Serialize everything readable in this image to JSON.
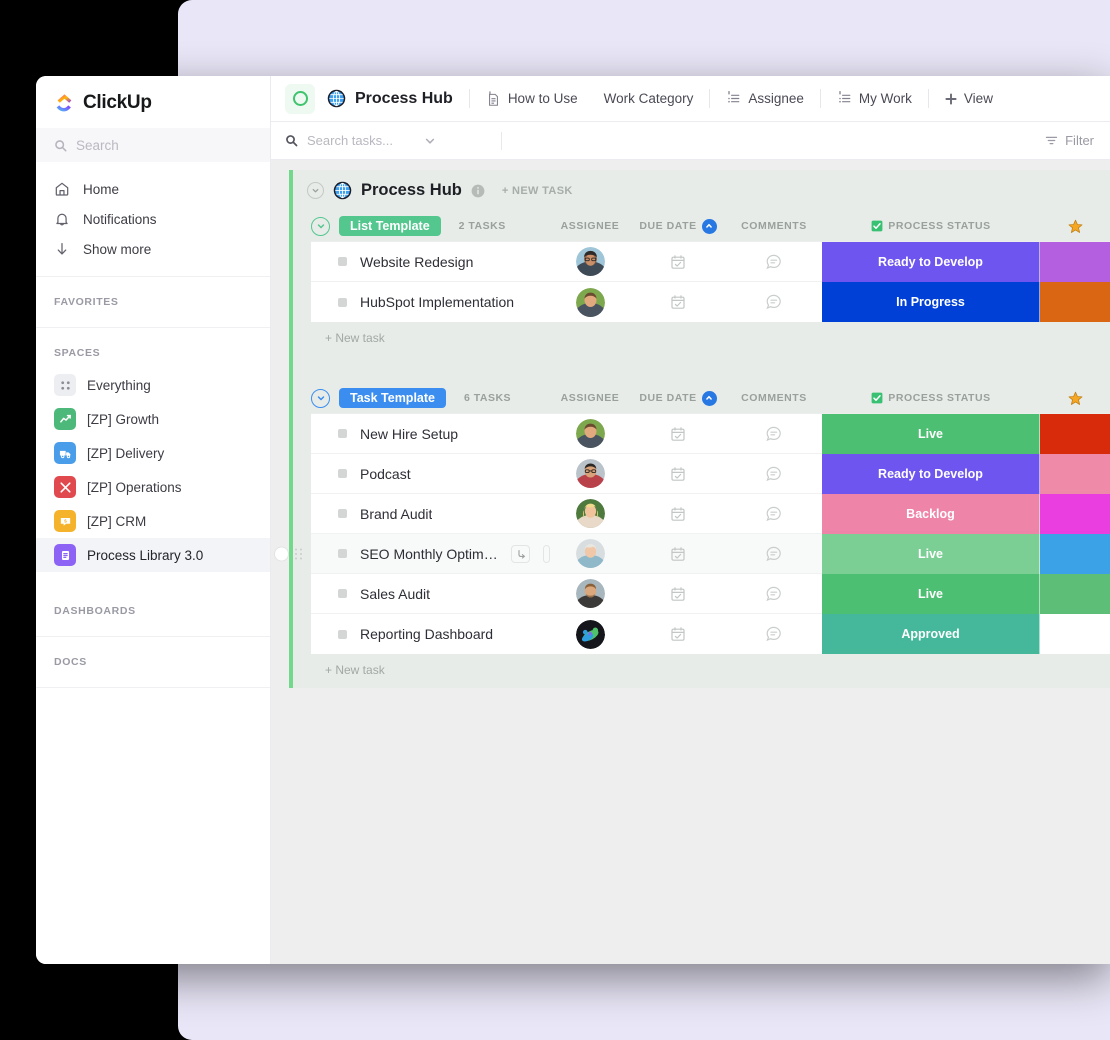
{
  "brand": {
    "name": "ClickUp",
    "logo_icon": "clickup-logo-icon"
  },
  "sidebar": {
    "search_placeholder": "Search",
    "nav": [
      {
        "label": "Home",
        "icon": "home-icon"
      },
      {
        "label": "Notifications",
        "icon": "bell-icon"
      },
      {
        "label": "Show more",
        "icon": "arrow-down-icon"
      }
    ],
    "favorites_label": "FAVORITES",
    "spaces_label": "SPACES",
    "spaces": [
      {
        "label": "Everything",
        "icon": "grid-dots-icon",
        "color": "#eceef1",
        "fg": "#8b8e96",
        "active": false
      },
      {
        "label": "[ZP] Growth",
        "icon": "chart-icon",
        "color": "#4cb97a",
        "fg": "#ffffff",
        "active": false
      },
      {
        "label": "[ZP] Delivery",
        "icon": "truck-icon",
        "color": "#4a9de8",
        "fg": "#ffffff",
        "active": false
      },
      {
        "label": "[ZP] Operations",
        "icon": "tools-icon",
        "color": "#e04a4f",
        "fg": "#ffffff",
        "active": false
      },
      {
        "label": "[ZP] CRM",
        "icon": "chat-money-icon",
        "color": "#f5b32c",
        "fg": "#ffffff",
        "active": false
      },
      {
        "label": "Process Library 3.0",
        "icon": "document-icon",
        "color": "#8c63f5",
        "fg": "#ffffff",
        "active": true
      }
    ],
    "dashboards_label": "DASHBOARDS",
    "docs_label": "DOCS"
  },
  "topbar": {
    "view_toggle_icon": "circle-outline-icon",
    "space_icon": "globe-icon",
    "space_title": "Process Hub",
    "tabs": [
      {
        "label": "How to Use",
        "icon": "doc-pin-icon"
      },
      {
        "label": "Work Category",
        "icon": ""
      },
      {
        "label": "Assignee",
        "icon": "list-pin-icon"
      },
      {
        "label": "My Work",
        "icon": "list-pin-icon"
      }
    ],
    "add_view_label": "View",
    "add_view_icon": "plus-icon"
  },
  "filterbar": {
    "search_placeholder": "Search tasks...",
    "search_icon": "search-icon",
    "chevron_icon": "chevron-down-icon",
    "filter_label": "Filter",
    "filter_icon": "filter-icon"
  },
  "list": {
    "accent_color": "#72d88b",
    "icon": "globe-icon",
    "title": "Process Hub",
    "info_icon": "info-icon",
    "new_task_label": "+ NEW TASK",
    "columns": {
      "assignee": "ASSIGNEE",
      "due_date": "DUE DATE",
      "comments": "COMMENTS",
      "process_status": "PROCESS STATUS",
      "status_check_icon": "green-check-icon",
      "star_icon": "star-icon",
      "sort_icon": "sort-asc-icon"
    },
    "add_task_label": "+ New task",
    "groups": [
      {
        "name": "List Template",
        "badge_color": "#54c78f",
        "task_count": "2 TASKS",
        "tasks": [
          {
            "title": "Website Redesign",
            "assignee": "avatar-woman-glasses",
            "due_icon": "calendar-check-icon",
            "comment_icon": "comment-icon",
            "status": "Ready to Develop",
            "status_color": "#6f55f0",
            "next_color": "#b45ee0"
          },
          {
            "title": "HubSpot Implementation",
            "assignee": "avatar-man-outdoor",
            "due_icon": "calendar-check-icon",
            "comment_icon": "comment-icon",
            "status": "In Progress",
            "status_color": "#0040d6",
            "next_color": "#da6614"
          }
        ]
      },
      {
        "name": "Task Template",
        "badge_color": "#3b8ef0",
        "task_count": "6 TASKS",
        "tasks": [
          {
            "title": "New Hire Setup",
            "assignee": "avatar-man-outdoor",
            "due_icon": "calendar-check-icon",
            "comment_icon": "comment-icon",
            "status": "Live",
            "status_color": "#4cbf72",
            "next_color": "#d82b0c"
          },
          {
            "title": "Podcast",
            "assignee": "avatar-man-glasses",
            "due_icon": "calendar-check-icon",
            "comment_icon": "comment-icon",
            "status": "Ready to Develop",
            "status_color": "#6f55f0",
            "next_color": "#ef8aa8"
          },
          {
            "title": "Brand Audit",
            "assignee": "avatar-woman-blonde",
            "due_icon": "calendar-check-icon",
            "comment_icon": "comment-icon",
            "status": "Backlog",
            "status_color": "#ee85a8",
            "next_color": "#ea3ee0"
          },
          {
            "title": "SEO Monthly Optimization",
            "assignee": "avatar-woman-short-hair",
            "due_icon": "calendar-check-icon",
            "comment_icon": "comment-icon",
            "status": "Live",
            "status_color": "#7bcf94",
            "next_color": "#3ba2e8",
            "hovered": true,
            "subtask_icon": "subtask-icon"
          },
          {
            "title": "Sales Audit",
            "assignee": "avatar-man-beard",
            "due_icon": "calendar-check-icon",
            "comment_icon": "comment-icon",
            "status": "Live",
            "status_color": "#4cbf72",
            "next_color": "#5dbf77"
          },
          {
            "title": "Reporting Dashboard",
            "assignee": "avatar-logo-dark",
            "due_icon": "calendar-check-icon",
            "comment_icon": "comment-icon",
            "status": "Approved",
            "status_color": "#45b89c",
            "next_color": "#ffffff"
          }
        ]
      }
    ]
  }
}
